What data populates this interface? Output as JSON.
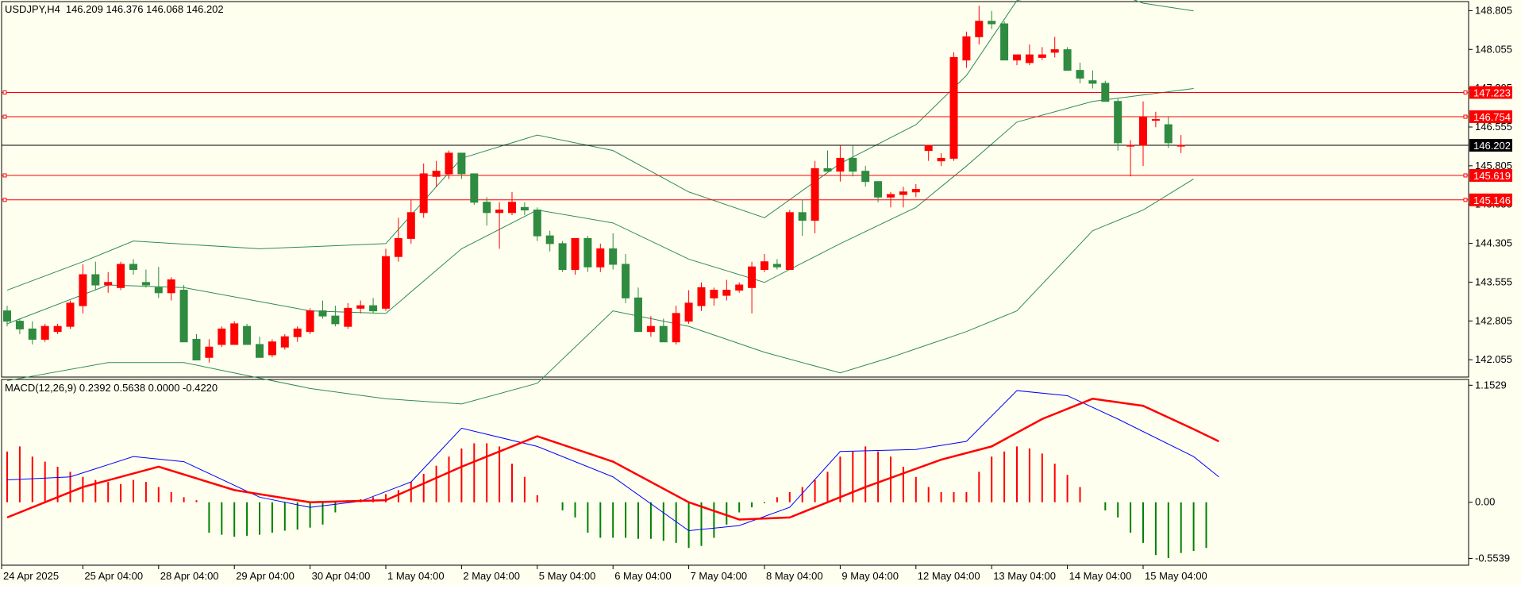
{
  "chart_data": {
    "type": "candlestick",
    "symbol_label": "USDJPY,H4",
    "ohlc_label": "146.209 146.376 146.068 146.202",
    "price_axis": {
      "range": [
        141.72,
        148.98
      ],
      "ticks": [
        "148.805",
        "148.055",
        "147.305",
        "146.555",
        "145.805",
        "145.055",
        "144.305",
        "143.555",
        "142.805",
        "142.055"
      ],
      "tick_values": [
        148.805,
        148.055,
        147.305,
        146.555,
        145.805,
        145.055,
        144.305,
        143.555,
        142.805,
        142.055
      ]
    },
    "time_axis": {
      "labels": [
        "24 Apr 2025",
        "25 Apr 04:00",
        "28 Apr 04:00",
        "29 Apr 04:00",
        "30 Apr 04:00",
        "1 May 04:00",
        "2 May 04:00",
        "5 May 04:00",
        "6 May 04:00",
        "7 May 04:00",
        "8 May 04:00",
        "9 May 04:00",
        "12 May 04:00",
        "13 May 04:00",
        "14 May 04:00",
        "15 May 04:00"
      ],
      "label_bars": [
        0,
        6,
        12,
        18,
        24,
        30,
        36,
        42,
        48,
        54,
        60,
        66,
        72,
        78,
        84,
        90
      ]
    },
    "candles": [
      [
        143.0,
        143.1,
        142.7,
        142.8
      ],
      [
        142.8,
        142.85,
        142.55,
        142.65
      ],
      [
        142.65,
        142.8,
        142.35,
        142.45
      ],
      [
        142.45,
        142.75,
        142.4,
        142.7
      ],
      [
        142.6,
        142.75,
        142.55,
        142.7
      ],
      [
        142.7,
        143.2,
        142.65,
        143.15
      ],
      [
        143.1,
        143.9,
        142.95,
        143.7
      ],
      [
        143.7,
        143.95,
        143.4,
        143.5
      ],
      [
        143.5,
        143.75,
        143.35,
        143.55
      ],
      [
        143.45,
        143.95,
        143.4,
        143.9
      ],
      [
        143.9,
        144.0,
        143.7,
        143.8
      ],
      [
        143.55,
        143.8,
        143.45,
        143.5
      ],
      [
        143.45,
        143.85,
        143.25,
        143.35
      ],
      [
        143.35,
        143.65,
        143.2,
        143.6
      ],
      [
        143.4,
        143.5,
        142.45,
        142.4
      ],
      [
        142.45,
        142.55,
        142.05,
        142.05
      ],
      [
        142.1,
        142.45,
        142.0,
        142.3
      ],
      [
        142.35,
        142.7,
        142.3,
        142.65
      ],
      [
        142.35,
        142.8,
        142.35,
        142.75
      ],
      [
        142.7,
        142.75,
        142.35,
        142.35
      ],
      [
        142.35,
        142.5,
        142.1,
        142.1
      ],
      [
        142.15,
        142.45,
        142.1,
        142.4
      ],
      [
        142.3,
        142.55,
        142.25,
        142.5
      ],
      [
        142.5,
        142.7,
        142.4,
        142.65
      ],
      [
        142.6,
        143.05,
        142.55,
        143.0
      ],
      [
        143.0,
        143.2,
        142.85,
        142.9
      ],
      [
        142.9,
        143.1,
        142.7,
        142.75
      ],
      [
        142.7,
        143.15,
        142.65,
        143.05
      ],
      [
        143.05,
        143.2,
        142.95,
        143.1
      ],
      [
        143.1,
        143.25,
        142.95,
        143.0
      ],
      [
        143.05,
        144.2,
        143.0,
        144.05
      ],
      [
        144.05,
        144.8,
        143.95,
        144.4
      ],
      [
        144.4,
        145.15,
        144.3,
        144.9
      ],
      [
        144.9,
        145.85,
        144.8,
        145.65
      ],
      [
        145.6,
        145.9,
        145.4,
        145.7
      ],
      [
        145.65,
        146.1,
        145.55,
        146.05
      ],
      [
        146.05,
        146.05,
        145.55,
        145.65
      ],
      [
        145.65,
        145.65,
        145.05,
        145.1
      ],
      [
        145.1,
        145.2,
        144.65,
        144.9
      ],
      [
        144.9,
        145.1,
        144.2,
        144.95
      ],
      [
        144.9,
        145.3,
        144.85,
        145.1
      ],
      [
        145.0,
        145.1,
        144.85,
        144.95
      ],
      [
        144.95,
        145.0,
        144.35,
        144.45
      ],
      [
        144.45,
        144.55,
        144.15,
        144.3
      ],
      [
        144.3,
        144.35,
        143.75,
        143.8
      ],
      [
        143.8,
        144.4,
        143.7,
        144.4
      ],
      [
        144.4,
        144.45,
        143.75,
        143.85
      ],
      [
        143.85,
        144.3,
        143.75,
        144.2
      ],
      [
        144.2,
        144.5,
        143.8,
        143.9
      ],
      [
        143.9,
        144.1,
        143.15,
        143.25
      ],
      [
        143.25,
        143.45,
        142.7,
        142.6
      ],
      [
        142.6,
        142.9,
        142.5,
        142.7
      ],
      [
        142.7,
        142.85,
        142.4,
        142.4
      ],
      [
        142.4,
        143.1,
        142.35,
        142.95
      ],
      [
        142.8,
        143.4,
        142.75,
        143.15
      ],
      [
        143.1,
        143.55,
        143.0,
        143.45
      ],
      [
        143.25,
        143.45,
        143.1,
        143.4
      ],
      [
        143.3,
        143.6,
        143.2,
        143.4
      ],
      [
        143.4,
        143.55,
        143.35,
        143.5
      ],
      [
        143.45,
        143.95,
        142.95,
        143.85
      ],
      [
        143.8,
        144.1,
        143.75,
        143.95
      ],
      [
        143.9,
        144.0,
        143.8,
        143.85
      ],
      [
        143.8,
        144.95,
        143.8,
        144.9
      ],
      [
        144.9,
        145.15,
        144.45,
        144.75
      ],
      [
        144.75,
        145.9,
        144.5,
        145.75
      ],
      [
        145.75,
        146.1,
        145.7,
        145.7
      ],
      [
        145.7,
        146.2,
        145.5,
        145.95
      ],
      [
        145.95,
        146.2,
        145.6,
        145.7
      ],
      [
        145.7,
        145.8,
        145.4,
        145.5
      ],
      [
        145.5,
        145.5,
        145.1,
        145.2
      ],
      [
        145.2,
        145.3,
        145.0,
        145.25
      ],
      [
        145.25,
        145.4,
        145.0,
        145.3
      ],
      [
        145.3,
        145.45,
        145.2,
        145.35
      ],
      [
        146.1,
        146.15,
        145.9,
        146.2
      ],
      [
        145.9,
        146.05,
        145.8,
        145.95
      ],
      [
        145.95,
        148.0,
        145.9,
        147.9
      ],
      [
        147.85,
        148.4,
        147.7,
        148.3
      ],
      [
        148.3,
        148.9,
        148.15,
        148.6
      ],
      [
        148.6,
        148.8,
        148.45,
        148.55
      ],
      [
        148.55,
        148.6,
        147.85,
        147.85
      ],
      [
        147.85,
        147.95,
        147.75,
        147.95
      ],
      [
        147.8,
        148.15,
        147.75,
        147.95
      ],
      [
        147.9,
        148.1,
        147.85,
        147.95
      ],
      [
        148.0,
        148.3,
        147.9,
        148.05
      ],
      [
        148.05,
        148.1,
        147.65,
        147.65
      ],
      [
        147.65,
        147.8,
        147.4,
        147.5
      ],
      [
        147.45,
        147.65,
        147.3,
        147.4
      ],
      [
        147.4,
        147.45,
        147.05,
        147.05
      ],
      [
        147.05,
        147.1,
        146.1,
        146.25
      ],
      [
        146.2,
        146.3,
        145.6,
        146.2
      ],
      [
        146.2,
        147.05,
        145.8,
        146.75
      ],
      [
        146.7,
        146.85,
        146.55,
        146.7
      ],
      [
        146.6,
        146.75,
        146.15,
        146.25
      ],
      [
        146.2,
        146.4,
        146.05,
        146.2
      ]
    ],
    "bollinger": {
      "upper": [
        [
          0,
          143.4
        ],
        [
          6,
          143.95
        ],
        [
          10,
          144.35
        ],
        [
          20,
          144.2
        ],
        [
          30,
          144.3
        ],
        [
          36,
          145.95
        ],
        [
          42,
          146.4
        ],
        [
          48,
          146.1
        ],
        [
          54,
          145.3
        ],
        [
          60,
          144.8
        ],
        [
          66,
          145.85
        ],
        [
          72,
          146.6
        ],
        [
          76,
          147.55
        ],
        [
          80,
          149.0
        ],
        [
          86,
          149.3
        ],
        [
          90,
          148.95
        ],
        [
          94,
          148.8
        ]
      ],
      "middle": [
        [
          0,
          142.75
        ],
        [
          8,
          143.5
        ],
        [
          14,
          143.45
        ],
        [
          24,
          143.0
        ],
        [
          30,
          142.95
        ],
        [
          36,
          144.2
        ],
        [
          42,
          144.95
        ],
        [
          48,
          144.7
        ],
        [
          54,
          144.0
        ],
        [
          60,
          143.55
        ],
        [
          66,
          144.3
        ],
        [
          72,
          145.0
        ],
        [
          76,
          145.8
        ],
        [
          80,
          146.65
        ],
        [
          86,
          147.05
        ],
        [
          94,
          147.3
        ]
      ],
      "lower": [
        [
          0,
          141.65
        ],
        [
          8,
          142.0
        ],
        [
          14,
          142.0
        ],
        [
          24,
          141.5
        ],
        [
          30,
          141.3
        ],
        [
          36,
          141.2
        ],
        [
          42,
          141.6
        ],
        [
          48,
          143.0
        ],
        [
          54,
          142.7
        ],
        [
          60,
          142.2
        ],
        [
          66,
          141.8
        ],
        [
          70,
          142.1
        ],
        [
          76,
          142.6
        ],
        [
          80,
          143.0
        ],
        [
          86,
          144.55
        ],
        [
          90,
          144.95
        ],
        [
          94,
          145.55
        ]
      ]
    },
    "hlines": [
      {
        "label": "147.223",
        "value": 147.223,
        "color": "#ff0000"
      },
      {
        "label": "146.754",
        "value": 146.754,
        "color": "#ff0000"
      },
      {
        "label": "146.202",
        "value": 146.202,
        "color": "#000000"
      },
      {
        "label": "145.619",
        "value": 145.619,
        "color": "#ff0000"
      },
      {
        "label": "145.146",
        "value": 145.146,
        "color": "#ff0000"
      }
    ],
    "macd": {
      "label": "MACD(12,26,9) 0.2392 0.5638 0.0000 -0.4220",
      "range": [
        -0.62,
        1.21
      ],
      "ticks": [
        "1.1529",
        "0.00",
        "-0.5539"
      ],
      "tick_values": [
        1.1529,
        0.0,
        -0.5539
      ],
      "histogram": [
        0.5,
        0.55,
        0.45,
        0.4,
        0.35,
        0.3,
        0.25,
        0.22,
        0.2,
        0.18,
        0.22,
        0.2,
        0.15,
        0.1,
        0.05,
        0.02,
        -0.3,
        -0.32,
        -0.34,
        -0.33,
        -0.32,
        -0.3,
        -0.28,
        -0.27,
        -0.25,
        -0.22,
        -0.1,
        0.02,
        0.03,
        0.05,
        0.08,
        0.12,
        0.2,
        0.28,
        0.36,
        0.45,
        0.53,
        0.58,
        0.58,
        0.55,
        0.38,
        0.25,
        0.07,
        0.0,
        -0.08,
        -0.15,
        -0.3,
        -0.35,
        -0.35,
        -0.35,
        -0.36,
        -0.36,
        -0.38,
        -0.4,
        -0.45,
        -0.43,
        -0.35,
        -0.22,
        -0.1,
        -0.05,
        -0.01,
        0.05,
        0.1,
        0.15,
        0.22,
        0.3,
        0.45,
        0.5,
        0.55,
        0.5,
        0.45,
        0.35,
        0.25,
        0.15,
        0.1,
        0.1,
        0.1,
        0.3,
        0.45,
        0.5,
        0.55,
        0.53,
        0.48,
        0.38,
        0.27,
        0.15,
        0.0,
        -0.08,
        -0.15,
        -0.3,
        -0.4,
        -0.52,
        -0.55,
        -0.5,
        -0.48,
        -0.45
      ],
      "macd_line": [
        [
          0,
          0.22
        ],
        [
          5,
          0.25
        ],
        [
          10,
          0.45
        ],
        [
          14,
          0.4
        ],
        [
          20,
          0.05
        ],
        [
          24,
          -0.05
        ],
        [
          28,
          0.01
        ],
        [
          32,
          0.2
        ],
        [
          36,
          0.73
        ],
        [
          42,
          0.55
        ],
        [
          48,
          0.25
        ],
        [
          54,
          -0.28
        ],
        [
          58,
          -0.23
        ],
        [
          62,
          -0.05
        ],
        [
          66,
          0.5
        ],
        [
          72,
          0.52
        ],
        [
          76,
          0.6
        ],
        [
          80,
          1.1
        ],
        [
          84,
          1.05
        ],
        [
          88,
          0.82
        ],
        [
          94,
          0.45
        ],
        [
          96,
          0.25
        ]
      ],
      "signal_line": [
        [
          0,
          -0.15
        ],
        [
          6,
          0.15
        ],
        [
          12,
          0.35
        ],
        [
          18,
          0.12
        ],
        [
          24,
          0.0
        ],
        [
          30,
          0.02
        ],
        [
          36,
          0.35
        ],
        [
          42,
          0.65
        ],
        [
          48,
          0.4
        ],
        [
          54,
          0.0
        ],
        [
          58,
          -0.17
        ],
        [
          62,
          -0.15
        ],
        [
          68,
          0.15
        ],
        [
          74,
          0.42
        ],
        [
          78,
          0.55
        ],
        [
          82,
          0.82
        ],
        [
          86,
          1.02
        ],
        [
          90,
          0.95
        ],
        [
          94,
          0.72
        ],
        [
          96,
          0.6
        ]
      ]
    },
    "colors": {
      "background": "#fffff0",
      "bull": "#ff0000",
      "bear": "#2e8b3f",
      "bands": "#2e8b57",
      "macd_line": "#0000ff",
      "signal_line": "#ff0000",
      "hist_pos": "#ff0000",
      "hist_neg": "#008000"
    },
    "grid": false
  }
}
